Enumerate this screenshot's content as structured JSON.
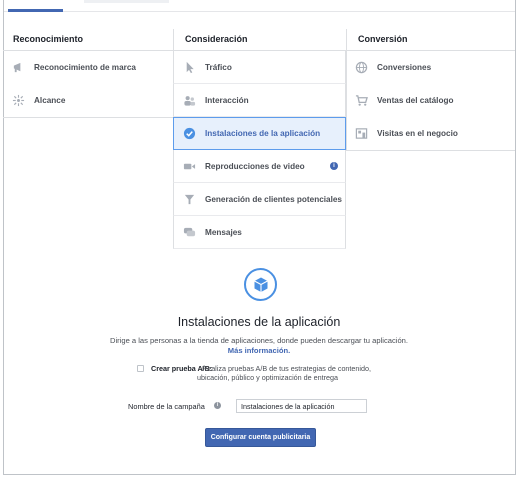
{
  "columns": [
    {
      "header": "Reconocimiento",
      "items": [
        {
          "label": "Reconocimiento de marca",
          "icon": "megaphone-icon"
        },
        {
          "label": "Alcance",
          "icon": "reach-icon"
        }
      ]
    },
    {
      "header": "Consideración",
      "items": [
        {
          "label": "Tráfico",
          "icon": "cursor-icon"
        },
        {
          "label": "Interacción",
          "icon": "people-icon"
        },
        {
          "label": "Instalaciones de la aplicación",
          "icon": "check-circle-icon",
          "selected": true
        },
        {
          "label": "Reproducciones de video",
          "icon": "video-icon",
          "info": "i"
        },
        {
          "label": "Generación de clientes potenciales",
          "icon": "funnel-icon"
        },
        {
          "label": "Mensajes",
          "icon": "chat-icon"
        }
      ]
    },
    {
      "header": "Conversión",
      "items": [
        {
          "label": "Conversiones",
          "icon": "globe-icon"
        },
        {
          "label": "Ventas del catálogo",
          "icon": "cart-icon"
        },
        {
          "label": "Visitas en el negocio",
          "icon": "store-icon"
        }
      ]
    }
  ],
  "detail": {
    "icon": "cube-icon",
    "title": "Instalaciones de la aplicación",
    "description": "Dirige a las personas a la tienda de aplicaciones, donde pueden descargar tu aplicación.",
    "link": "Más información."
  },
  "ab_test": {
    "label": "Crear prueba A/B:",
    "text_line1": "Realiza pruebas A/B de tus estrategias de contenido,",
    "text_line2": "ubicación, público y optimización de entrega",
    "checked": false
  },
  "campaign_name": {
    "label": "Nombre de la campaña",
    "info": "i",
    "value": "Instalaciones de la aplicación"
  },
  "cta": {
    "label": "Configurar cuenta publicitaria"
  },
  "colors": {
    "accent": "#4267b2",
    "selected_bg": "#e7f0fc",
    "selected_border": "#5d9cec",
    "icon_gray": "#a7adb6"
  }
}
